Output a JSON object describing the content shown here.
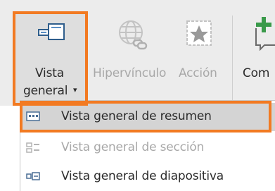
{
  "ribbon": {
    "vista_general": {
      "line1": "Vista",
      "line2": "general",
      "arrow": "▾",
      "icon": "zoom-summary-icon"
    },
    "hipervinculo": {
      "label": "Hipervínculo",
      "icon": "globe-link-icon"
    },
    "accion": {
      "label": "Acción",
      "icon": "star-action-icon"
    },
    "comentario": {
      "label": "Com",
      "icon": "new-comment-icon"
    }
  },
  "menu": {
    "items": [
      {
        "label": "Vista general de resumen",
        "state": "selected",
        "icon": "summary-zoom-icon"
      },
      {
        "label": "Vista general de sección",
        "state": "disabled",
        "icon": "section-zoom-icon"
      },
      {
        "label": "Vista general de diapositiva",
        "state": "enabled",
        "icon": "slide-zoom-icon"
      }
    ]
  },
  "colors": {
    "highlight": "#f27a22",
    "ribbon_bg": "#ececec",
    "menu_selected_bg": "#d4d4d4",
    "disabled_text": "#a8a8a8"
  }
}
